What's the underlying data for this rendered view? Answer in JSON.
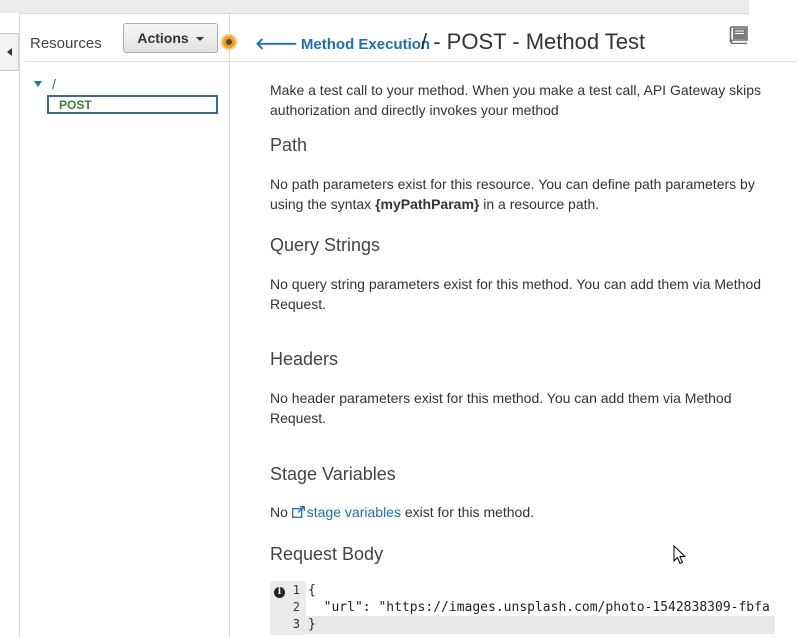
{
  "sidebar": {
    "title": "Resources",
    "actions_label": "Actions",
    "tree": {
      "root_label": "/",
      "method_label": "POST"
    }
  },
  "header": {
    "back_label": "Method Execution",
    "title": "/ - POST - Method Test"
  },
  "intro": "Make a test call to your method. When you make a test call, API Gateway skips authorization and directly invokes your method",
  "sections": {
    "path": {
      "heading": "Path",
      "text_before": "No path parameters exist for this resource. You can define path parameters by using the syntax ",
      "text_bold": "{myPathParam}",
      "text_after": " in a resource path."
    },
    "query": {
      "heading": "Query Strings",
      "text": "No query string parameters exist for this method. You can add them via Method Request."
    },
    "headers": {
      "heading": "Headers",
      "text": "No header parameters exist for this method. You can add them via Method Request."
    },
    "stage": {
      "heading": "Stage Variables",
      "text_before": "No ",
      "link_label": "stage variables",
      "text_after": " exist for this method."
    },
    "body": {
      "heading": "Request Body"
    }
  },
  "editor": {
    "line_numbers": [
      "1",
      "2",
      "3"
    ],
    "lines": [
      "{",
      "  \"url\": \"https://images.unsplash.com/photo-1542838309-fbfa",
      "}"
    ]
  },
  "icons": {
    "collapse": "chevron-left-icon",
    "book": "book-icon",
    "info": "info-icon",
    "external_link": "external-link-icon",
    "status": "orange-dot-icon"
  },
  "colors": {
    "link": "#1f6fb2",
    "method_text": "#3b7d3b",
    "status_dot": "#f39c12"
  }
}
